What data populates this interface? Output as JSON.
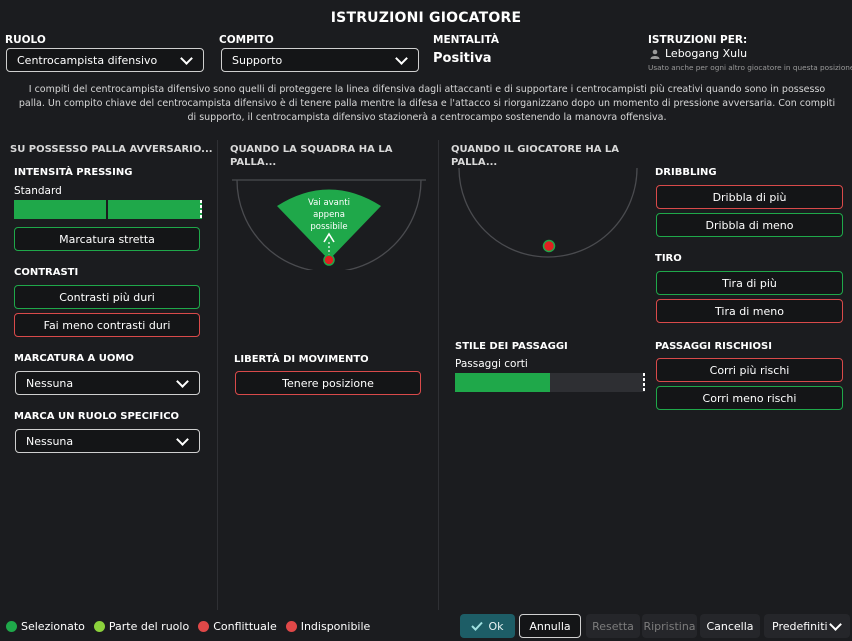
{
  "title": "ISTRUZIONI GIOCATORE",
  "header": {
    "role_label": "RUOLO",
    "role_value": "Centrocampista difensivo",
    "duty_label": "COMPITO",
    "duty_value": "Supporto",
    "mentality_label": "MENTALITÀ",
    "mentality_value": "Positiva",
    "instructions_for_label": "ISTRUZIONI PER:",
    "player_name": "Lebogang Xulu",
    "applies_note": "Usato anche per ogni altro giocatore in questa posizione"
  },
  "description": "I compiti del centrocampista difensivo sono quelli di proteggere la linea difensiva dagli attaccanti e di supportare i centrocampisti più creativi quando sono in possesso palla. Un compito chiave del centrocampista difensivo è di tenere palla mentre la difesa e l'attacco si riorganizzano dopo un momento di pressione avversaria. Con compiti di supporto, il centrocampista difensivo stazionerà a centrocampo sostenendo la manovra offensiva.",
  "col1": {
    "header": "SU POSSESSO PALLA AVVERSARIO...",
    "pressing_label": "INTENSITÀ PRESSING",
    "pressing_value": "Standard",
    "pressing_level": 1.0,
    "tight_marking": "Marcatura stretta",
    "tackling_label": "CONTRASTI",
    "tackle_harder": "Contrasti più duri",
    "tackle_less": "Fai meno contrasti duri",
    "man_marking_label": "MARCATURA A UOMO",
    "man_marking_value": "Nessuna",
    "mark_role_label": "MARCA UN RUOLO SPECIFICO",
    "mark_role_value": "Nessuna"
  },
  "col2": {
    "header": "QUANDO LA SQUADRA HA LA PALLA...",
    "zone_text": "Vai avanti appena possibile",
    "freedom_label": "LIBERTÀ DI MOVIMENTO",
    "hold_position": "Tenere posizione"
  },
  "col3": {
    "header": "QUANDO IL GIOCATORE HA LA PALLA...",
    "passing_label": "STILE DEI PASSAGGI",
    "passing_value": "Passaggi corti",
    "passing_level": 0.5
  },
  "col4": {
    "dribbling_label": "DRIBBLING",
    "dribble_more": "Dribbla di più",
    "dribble_less": "Dribbla di meno",
    "shooting_label": "TIRO",
    "shoot_more": "Tira di più",
    "shoot_less": "Tira di meno",
    "risky_label": "PASSAGGI RISCHIOSI",
    "more_risks": "Corri più rischi",
    "less_risks": "Corri meno rischi"
  },
  "legend": {
    "selected": "Selezionato",
    "part_of_role": "Parte del ruolo",
    "conflicting": "Conflittuale",
    "unavailable": "Indisponibile"
  },
  "footer": {
    "ok": "Ok",
    "cancel_changes": "Annulla",
    "reset": "Resetta",
    "restore": "Ripristina",
    "clear": "Cancella",
    "defaults": "Predefiniti"
  },
  "colors": {
    "green": "#1fa84a",
    "lime": "#8cd23c",
    "red": "#e04848",
    "background": "#1b1c1f"
  }
}
